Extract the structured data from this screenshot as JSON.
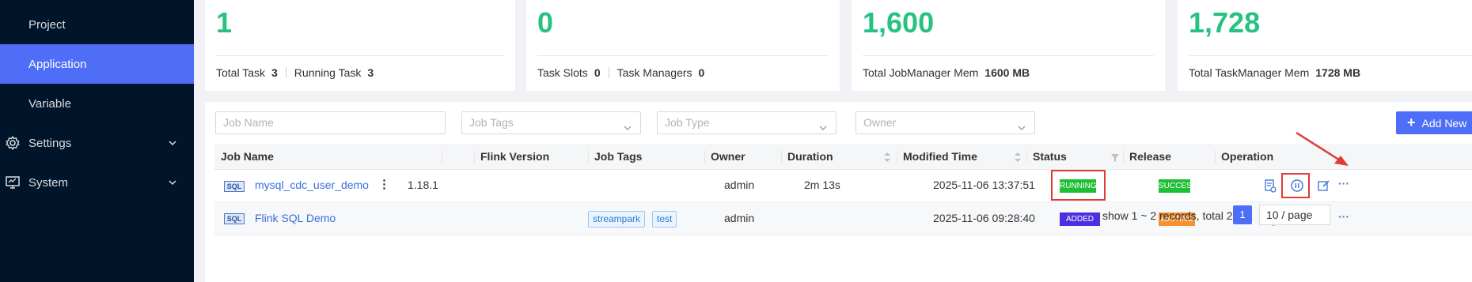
{
  "sidebar": {
    "items": [
      {
        "label": "Project"
      },
      {
        "label": "Application"
      },
      {
        "label": "Variable"
      },
      {
        "label": "Settings"
      },
      {
        "label": "System"
      }
    ]
  },
  "stats": [
    {
      "value": "1",
      "labels": [
        {
          "label": "Total Task",
          "value": "3"
        },
        {
          "label": "Running Task",
          "value": "3"
        }
      ]
    },
    {
      "value": "0",
      "labels": [
        {
          "label": "Task Slots",
          "value": "0"
        },
        {
          "label": "Task Managers",
          "value": "0"
        }
      ]
    },
    {
      "value": "1,600",
      "labels": [
        {
          "label": "Total JobManager Mem",
          "value": "1600 MB"
        }
      ]
    },
    {
      "value": "1,728",
      "labels": [
        {
          "label": "Total TaskManager Mem",
          "value": "1728 MB"
        }
      ]
    }
  ],
  "filters": {
    "job_name_placeholder": "Job Name",
    "job_tags_placeholder": "Job Tags",
    "job_type_placeholder": "Job Type",
    "owner_placeholder": "Owner",
    "add_new_label": "Add New"
  },
  "table": {
    "columns": [
      "Job Name",
      "Flink Version",
      "Job Tags",
      "Owner",
      "Duration",
      "Modified Time",
      "Status",
      "Release",
      "Operation"
    ],
    "rows": [
      {
        "type_badge": "SQL",
        "job_name": "mysql_cdc_user_demo",
        "flink_version": "1.18.1",
        "tags": [],
        "owner": "admin",
        "duration": "2m 13s",
        "modified_time": "2025-11-06 13:37:51",
        "status": "RUNNING",
        "release": "SUCCESS"
      },
      {
        "type_badge": "SQL",
        "job_name": "Flink SQL Demo",
        "flink_version": "",
        "tags": [
          "streampark",
          "test"
        ],
        "owner": "admin",
        "duration": "",
        "modified_time": "2025-11-06 09:28:40",
        "status": "ADDED",
        "release": "WAITING"
      }
    ]
  },
  "pagination": {
    "summary": "show 1 ~ 2 records, total 2",
    "current_page": "1",
    "page_size": "10 / page"
  },
  "colors": {
    "accent": "#4f6ef7",
    "running": "#1fbf35",
    "success": "#1fbf35",
    "added": "#4c2fe0",
    "waiting": "#f7902e",
    "highlight": "#e03a36"
  }
}
